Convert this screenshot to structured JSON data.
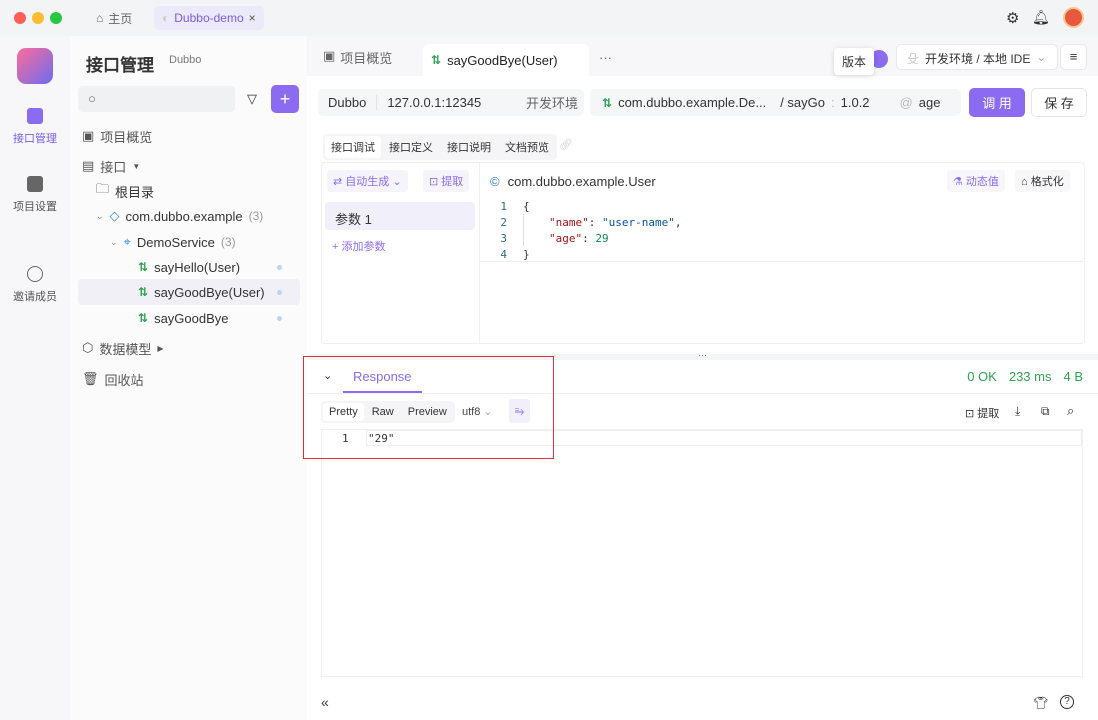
{
  "titlebar": {
    "home_tab": "主页",
    "project_tab": "Dubbo-demo"
  },
  "rail": {
    "items": [
      {
        "label": "接口管理"
      },
      {
        "label": "项目设置"
      },
      {
        "label": "邀请成员"
      }
    ]
  },
  "sidebar": {
    "title": "接口管理",
    "badge": "Dubbo",
    "search_placeholder": "",
    "nav": {
      "overview": "项目概览",
      "interfaces": "接口",
      "root": "根目录",
      "package": "com.dubbo.example",
      "package_count": "(3)",
      "service": "DemoService",
      "service_count": "(3)",
      "methods": [
        "sayHello(User)",
        "sayGoodBye(User)",
        "sayGoodBye"
      ],
      "data_model": "数据模型",
      "trash": "回收站"
    }
  },
  "tabs": {
    "overview": "项目概览",
    "active": "sayGoodBye(User)",
    "more": "···"
  },
  "env": {
    "selector": "开发环境 / 本地 IDE",
    "tooltip": "版本"
  },
  "request": {
    "protocol": "Dubbo",
    "address": "127.0.0.1:12345",
    "env": "开发环境",
    "service": "com.dubbo.example.De...",
    "method": "/ sayGo",
    "version": "1.0.2",
    "group": "age",
    "invoke": "调 用",
    "save": "保 存"
  },
  "subtabs": [
    "接口调试",
    "接口定义",
    "接口说明",
    "文档预览"
  ],
  "params": {
    "auto_gen": "自动生成",
    "extract": "提取",
    "param1": "参数 1",
    "add_param": "+ 添加参数",
    "class": "com.dubbo.example.User",
    "dynamic": "动态值",
    "format": "格式化",
    "code_lines": [
      {
        "n": "1"
      },
      {
        "n": "2",
        "key": "\"name\"",
        "val": "\"user-name\""
      },
      {
        "n": "3",
        "key": "\"age\"",
        "num": "29"
      },
      {
        "n": "4"
      }
    ]
  },
  "response": {
    "tab": "Response",
    "status": "0 OK",
    "time": "233 ms",
    "size": "4 B",
    "modes": [
      "Pretty",
      "Raw",
      "Preview"
    ],
    "encoding": "utf8",
    "extract": "提取",
    "line_no": "1",
    "body": "\"29\""
  },
  "colors": {
    "accent": "#8b6cf0",
    "green": "#2da44e",
    "highlight_box": "#e0303a"
  }
}
